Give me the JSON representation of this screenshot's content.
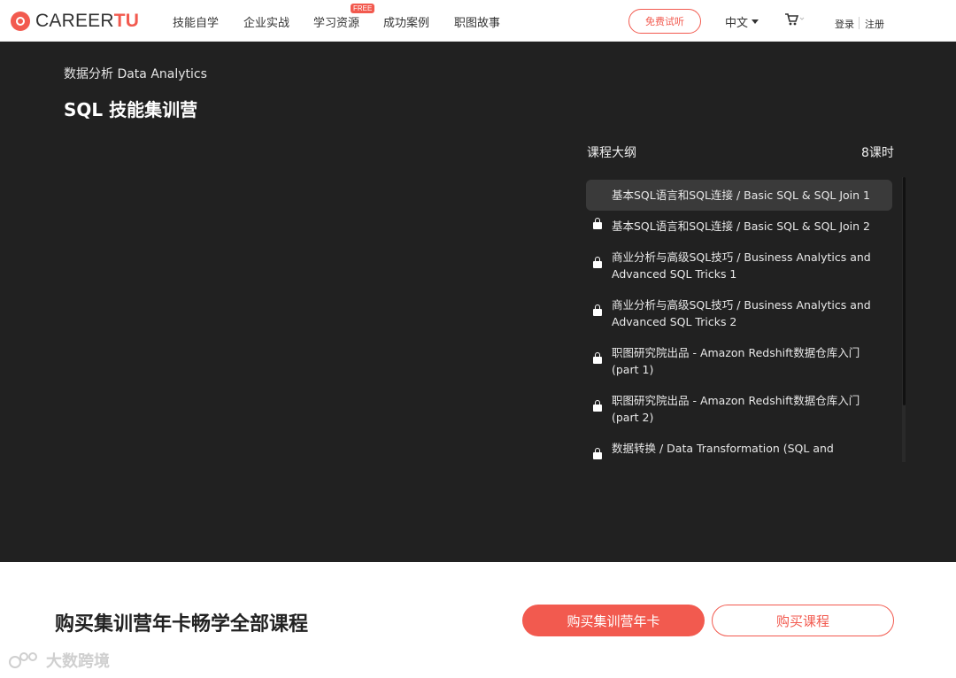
{
  "header": {
    "logo": {
      "text_main": "CAREER",
      "text_accent": "TU",
      "icon": "career-tu-logo-icon"
    },
    "nav": [
      {
        "label": "技能自学"
      },
      {
        "label": "企业实战"
      },
      {
        "label": "学习资源",
        "badge": "FREE"
      },
      {
        "label": "成功案例"
      },
      {
        "label": "职图故事"
      }
    ],
    "trial_label": "免费试听",
    "language": "中文",
    "cart_icon": "cart-icon",
    "login": "登录",
    "register": "注册"
  },
  "hero": {
    "breadcrumb": "数据分析 Data Analytics",
    "title": "SQL 技能集训营",
    "outline_title": "课程大纲",
    "lesson_count": "8课时",
    "lessons": [
      {
        "title": "基本SQL语言和SQL连接 / Basic SQL & SQL Join 1",
        "icon": "play-icon",
        "active": true
      },
      {
        "title": "基本SQL语言和SQL连接 / Basic SQL & SQL Join 2",
        "icon": "lock-icon"
      },
      {
        "title": "商业分析与高级SQL技巧 / Business Analytics and Advanced SQL Tricks 1",
        "icon": "lock-icon"
      },
      {
        "title": "商业分析与高级SQL技巧 / Business Analytics and Advanced SQL Tricks 2",
        "icon": "lock-icon"
      },
      {
        "title": "职图研究院出品 - Amazon Redshift数据仓库入门 (part 1)",
        "icon": "lock-icon"
      },
      {
        "title": "职图研究院出品 - Amazon Redshift数据仓库入门 (part 2)",
        "icon": "lock-icon"
      },
      {
        "title": "数据转换 / Data Transformation (SQL and",
        "icon": "lock-icon"
      }
    ]
  },
  "purchase": {
    "title": "购买集训营年卡畅学全部课程",
    "annual_card_label": "购买集训营年卡",
    "course_label": "购买课程"
  },
  "watermark": {
    "text": "大数跨境"
  },
  "colors": {
    "accent": "#f25a4f",
    "hero_bg": "#212121",
    "active_lesson_bg": "#3a3a3a"
  }
}
